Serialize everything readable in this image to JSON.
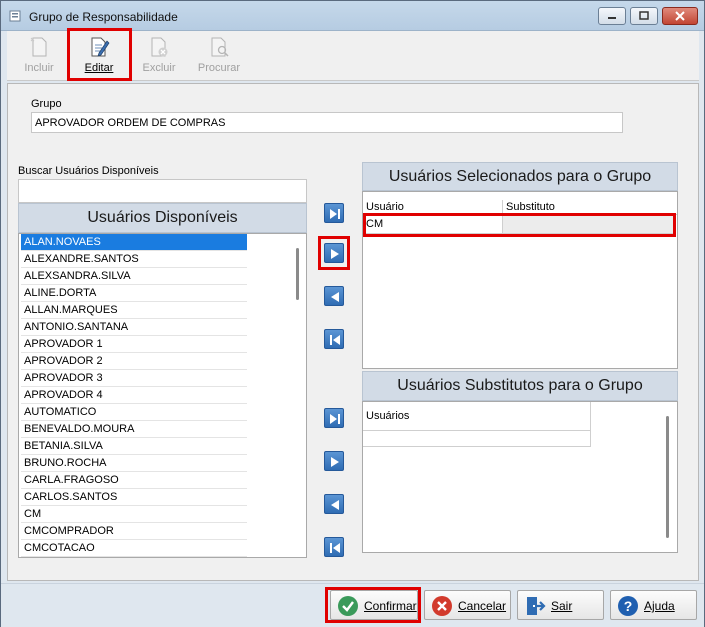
{
  "window": {
    "title": "Grupo de Responsabilidade"
  },
  "toolbar": {
    "incluir": "Incluir",
    "editar": "Editar",
    "excluir": "Excluir",
    "procurar": "Procurar"
  },
  "group": {
    "label": "Grupo",
    "value": "APROVADOR ORDEM DE COMPRAS"
  },
  "search": {
    "label": "Buscar Usuários Disponíveis",
    "value": ""
  },
  "available": {
    "header": "Usuários Disponíveis",
    "items": [
      "ALAN.NOVAES",
      "ALEXANDRE.SANTOS",
      "ALEXSANDRA.SILVA",
      "ALINE.DORTA",
      "ALLAN.MARQUES",
      "ANTONIO.SANTANA",
      "APROVADOR 1",
      "APROVADOR 2",
      "APROVADOR 3",
      "APROVADOR 4",
      "AUTOMATICO",
      "BENEVALDO.MOURA",
      "BETANIA.SILVA",
      "BRUNO.ROCHA",
      "CARLA.FRAGOSO",
      "CARLOS.SANTOS",
      "CM",
      "CMCOMPRADOR",
      "CMCOTACAO"
    ],
    "selected_index": 0
  },
  "selected": {
    "header": "Usuários Selecionados para o Grupo",
    "col_usuario": "Usuário",
    "col_substituto": "Substituto",
    "rows": [
      {
        "usuario": "CM",
        "substituto": ""
      }
    ]
  },
  "substitutes": {
    "header": "Usuários Substitutos para o Grupo",
    "col_usuarios": "Usuários"
  },
  "icons": {
    "add_all": "last-icon",
    "add": "play-right-icon",
    "remove": "play-left-icon",
    "remove_all": "first-icon"
  },
  "buttons": {
    "confirmar": "Confirmar",
    "cancelar": "Cancelar",
    "sair": "Sair",
    "ajuda": "Ajuda"
  },
  "colors": {
    "highlight": "#e00000",
    "accent": "#2f6cb3",
    "selection": "#1a7ce0"
  }
}
